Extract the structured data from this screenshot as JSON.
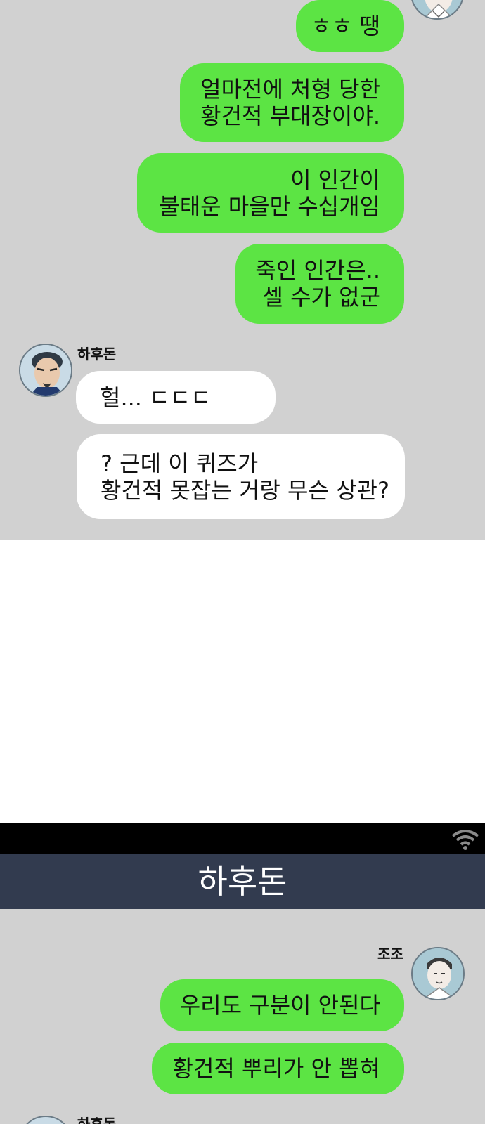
{
  "panel_top": {
    "messages_me": [
      {
        "lines": [
          "ㅎㅎ 땡"
        ]
      },
      {
        "lines": [
          "얼마전에 처형 당한",
          "황건적 부대장이야."
        ]
      },
      {
        "lines": [
          "이 인간이",
          "불태운 마을만 수십개임"
        ]
      },
      {
        "lines": [
          "죽인 인간은..",
          "셀 수가 없군"
        ]
      }
    ],
    "other_sender": {
      "name": "하후돈",
      "avatar": "hahudon-avatar"
    },
    "messages_other": [
      {
        "lines": [
          "헐... ㄷㄷㄷ"
        ]
      },
      {
        "lines": [
          "? 근데 이 퀴즈가",
          "황건적 못잡는 거랑 무슨 상관?"
        ]
      }
    ]
  },
  "status_bar": {
    "icon": "wifi-icon"
  },
  "chat_header": {
    "title": "하후돈"
  },
  "panel_bottom": {
    "me_sender": {
      "name": "조조",
      "avatar": "jojo-avatar"
    },
    "messages_me": [
      {
        "lines": [
          "우리도 구분이 안된다"
        ]
      },
      {
        "lines": [
          "황건적 뿌리가 안 뽑혀"
        ]
      }
    ],
    "other_sender": {
      "name": "하후돈",
      "avatar": "hahudon-avatar"
    }
  },
  "colors": {
    "chat_bg": "#d1d1d1",
    "my_bubble": "#5ce444",
    "other_bubble": "#ffffff",
    "header_bg": "#323b4f",
    "status_bg": "#000000"
  }
}
